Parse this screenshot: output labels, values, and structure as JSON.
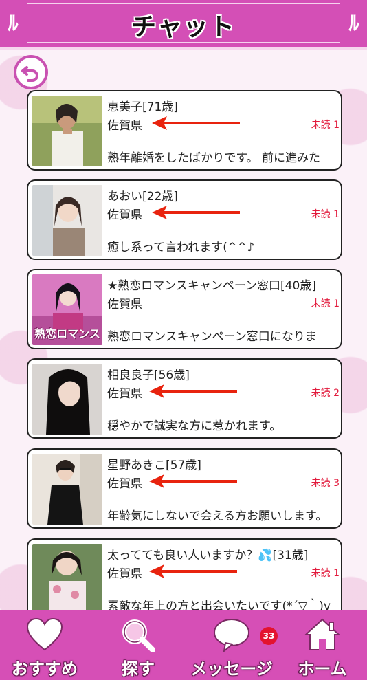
{
  "header": {
    "title": "チャット"
  },
  "back_button": {
    "icon": "back-arrow-icon"
  },
  "colors": {
    "brand": "#d44fb6",
    "unread": "#e21a3c",
    "arrow": "#e8230e",
    "badge": "#e3132f"
  },
  "chats": [
    {
      "name": "恵美子[71歳]",
      "prefecture": "佐賀県",
      "unread": "未読 1",
      "message": "熟年離婚をしたばかりです。 前に進みた",
      "photo": "woman-photo"
    },
    {
      "name": "あおい[22歳]",
      "prefecture": "佐賀県",
      "unread": "未読 1",
      "message": "癒し系って言われます(^^♪",
      "photo": "woman-photo"
    },
    {
      "name": "★熟恋ロマンスキャンペーン窓口[40歳]",
      "prefecture": "佐賀県",
      "unread": "未読 1",
      "message": "熟恋ロマンスキャンペーン窓口になりま",
      "photo": "campaign-photo",
      "photo_text": "熟恋ロマンス"
    },
    {
      "name": "相良良子[56歳]",
      "prefecture": "佐賀県",
      "unread": "未読 2",
      "message": "穏やかで誠実な方に惹かれます。",
      "photo": "woman-photo"
    },
    {
      "name": "星野あきこ[57歳]",
      "prefecture": "佐賀県",
      "unread": "未読 3",
      "message": "年齢気にしないで会える方お願いします。",
      "photo": "woman-photo"
    },
    {
      "name": "太ってても良い人いますか？💦[31歳]",
      "prefecture": "佐賀県",
      "unread": "未読 1",
      "message": "素敵な年上の方と出会いたいです(*´▽｀)v",
      "photo": "woman-photo"
    }
  ],
  "nav": {
    "recommend": "おすすめ",
    "search": "探す",
    "messages": "メッセージ",
    "messages_badge": "33",
    "home": "ホーム"
  }
}
